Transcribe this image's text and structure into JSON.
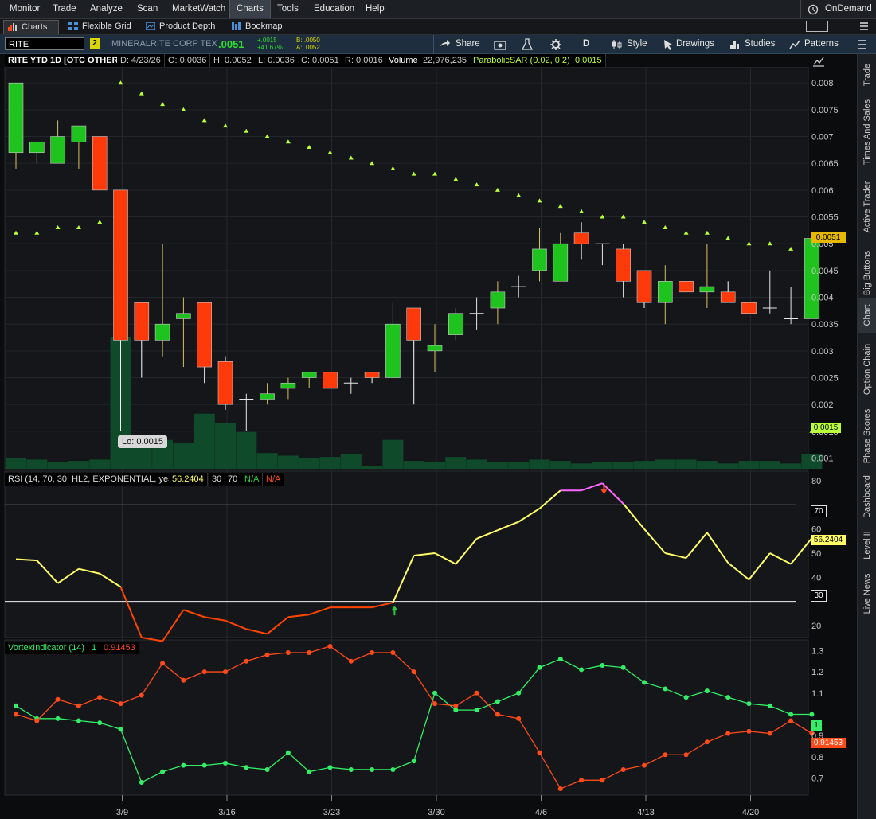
{
  "menu": {
    "items": [
      "Monitor",
      "Trade",
      "Analyze",
      "Scan",
      "MarketWatch",
      "Charts",
      "Tools",
      "Education",
      "Help"
    ],
    "active": "Charts",
    "ondemand": "OnDemand"
  },
  "subtabs": [
    "Charts",
    "Flexible Grid",
    "Product Depth",
    "Bookmap"
  ],
  "toolbar": {
    "symbol": "RITE",
    "link": "2",
    "company": "MINERALRITE CORP TEX",
    "last": ".0051",
    "change": "+.0015",
    "pct": "+41.67%",
    "bid": "B: .0050",
    "ask": "A: .0052",
    "share": "Share",
    "period": "D",
    "style": "Style",
    "drawings": "Drawings",
    "studies": "Studies",
    "patterns": "Patterns"
  },
  "header": {
    "title": "RITE YTD 1D [OTC OTHER]",
    "date": "D: 4/23/26",
    "open": "O: 0.0036",
    "high": "H: 0.0052",
    "low": "L: 0.0036",
    "close": "C: 0.0051",
    "range": "R: 0.0016",
    "volume_label": "Volume",
    "volume": "22,976,235",
    "sar_label": "ParabolicSAR (0.02, 0.2)",
    "sar_value": "0.0015"
  },
  "price_axis": [
    "0.008",
    "0.0075",
    "0.007",
    "0.0065",
    "0.006",
    "0.0055",
    "0.005",
    "0.0045",
    "0.004",
    "0.0035",
    "0.003",
    "0.0025",
    "0.002",
    "0.0015",
    "0.001"
  ],
  "price_badges": {
    "last": "0.0051",
    "sar": "0.0015"
  },
  "lo_label": "Lo: 0.0015",
  "rsi": {
    "label": "RSI (14, 70, 30, HL2, EXPONENTIAL, yes)",
    "value": "56.2404",
    "low": "30",
    "high": "70",
    "na1": "N/A",
    "na2": "N/A",
    "axis": [
      "80",
      "70",
      "60",
      "50",
      "40",
      "30",
      "20"
    ]
  },
  "vortex": {
    "label": "VortexIndicator (14)",
    "plus": "1",
    "minus": "0.91453",
    "axis": [
      "1.3",
      "1.2",
      "1.1",
      "1",
      "0.9",
      "0.8",
      "0.7"
    ]
  },
  "date_axis": [
    "3/9",
    "3/16",
    "3/23",
    "3/30",
    "4/6",
    "4/13",
    "4/20"
  ],
  "sidebar": [
    "Trade",
    "Times And Sales",
    "Active Trader",
    "Big Buttons",
    "Chart",
    "Option Chain",
    "Phase Scores",
    "Dashboard",
    "Level II",
    "Live News"
  ],
  "colors": {
    "up": "#1ec31e",
    "down": "#ff3a0a",
    "sar": "#b8ff3a",
    "volume": "#0f4a2a",
    "rsi_line": "#ffff66",
    "rsi_os": "#ff4500",
    "rsi_ob": "#ff66ff",
    "vi_plus": "#33ee66",
    "vi_minus": "#ff4a1a"
  },
  "chart_data": [
    {
      "type": "candlestick",
      "title": "RITE YTD 1D [OTC OTHER]",
      "candles": [
        {
          "o": 0.0067,
          "h": 0.008,
          "l": 0.0064,
          "c": 0.008
        },
        {
          "o": 0.0067,
          "h": 0.0069,
          "l": 0.0065,
          "c": 0.0069
        },
        {
          "o": 0.0065,
          "h": 0.0073,
          "l": 0.0065,
          "c": 0.007
        },
        {
          "o": 0.0069,
          "h": 0.0072,
          "l": 0.0064,
          "c": 0.0072
        },
        {
          "o": 0.007,
          "h": 0.007,
          "l": 0.006,
          "c": 0.006
        },
        {
          "o": 0.006,
          "h": 0.006,
          "l": 0.0015,
          "c": 0.0032
        },
        {
          "o": 0.0039,
          "h": 0.0039,
          "l": 0.0025,
          "c": 0.0032
        },
        {
          "o": 0.0032,
          "h": 0.005,
          "l": 0.0029,
          "c": 0.0035
        },
        {
          "o": 0.0036,
          "h": 0.004,
          "l": 0.0027,
          "c": 0.0037
        },
        {
          "o": 0.0039,
          "h": 0.0039,
          "l": 0.0024,
          "c": 0.0027
        },
        {
          "o": 0.0028,
          "h": 0.0029,
          "l": 0.0019,
          "c": 0.002
        },
        {
          "o": 0.0021,
          "h": 0.0022,
          "l": 0.0015,
          "c": 0.0021
        },
        {
          "o": 0.0021,
          "h": 0.0024,
          "l": 0.002,
          "c": 0.0022
        },
        {
          "o": 0.0023,
          "h": 0.0025,
          "l": 0.0021,
          "c": 0.0024
        },
        {
          "o": 0.0025,
          "h": 0.0026,
          "l": 0.0023,
          "c": 0.0026
        },
        {
          "o": 0.0026,
          "h": 0.0027,
          "l": 0.0022,
          "c": 0.0023
        },
        {
          "o": 0.0024,
          "h": 0.0025,
          "l": 0.0022,
          "c": 0.0024
        },
        {
          "o": 0.0026,
          "h": 0.0026,
          "l": 0.0024,
          "c": 0.0025
        },
        {
          "o": 0.0025,
          "h": 0.0039,
          "l": 0.0025,
          "c": 0.0035
        },
        {
          "o": 0.0038,
          "h": 0.0038,
          "l": 0.002,
          "c": 0.0032
        },
        {
          "o": 0.003,
          "h": 0.0035,
          "l": 0.0026,
          "c": 0.0031
        },
        {
          "o": 0.0033,
          "h": 0.0038,
          "l": 0.0032,
          "c": 0.0037
        },
        {
          "o": 0.0037,
          "h": 0.004,
          "l": 0.0034,
          "c": 0.0037
        },
        {
          "o": 0.0038,
          "h": 0.0043,
          "l": 0.0035,
          "c": 0.0041
        },
        {
          "o": 0.0042,
          "h": 0.0044,
          "l": 0.004,
          "c": 0.0042
        },
        {
          "o": 0.0045,
          "h": 0.0053,
          "l": 0.0043,
          "c": 0.0049
        },
        {
          "o": 0.0043,
          "h": 0.0052,
          "l": 0.0043,
          "c": 0.005
        },
        {
          "o": 0.0052,
          "h": 0.0054,
          "l": 0.0047,
          "c": 0.005
        },
        {
          "o": 0.005,
          "h": 0.005,
          "l": 0.0046,
          "c": 0.005
        },
        {
          "o": 0.0049,
          "h": 0.005,
          "l": 0.004,
          "c": 0.0043
        },
        {
          "o": 0.0045,
          "h": 0.0045,
          "l": 0.0038,
          "c": 0.0039
        },
        {
          "o": 0.0039,
          "h": 0.0046,
          "l": 0.0035,
          "c": 0.0043
        },
        {
          "o": 0.0043,
          "h": 0.0043,
          "l": 0.0041,
          "c": 0.0041
        },
        {
          "o": 0.0041,
          "h": 0.005,
          "l": 0.0038,
          "c": 0.0042
        },
        {
          "o": 0.0041,
          "h": 0.0043,
          "l": 0.0039,
          "c": 0.0039
        },
        {
          "o": 0.0039,
          "h": 0.0039,
          "l": 0.0033,
          "c": 0.0037
        },
        {
          "o": 0.0038,
          "h": 0.0045,
          "l": 0.0037,
          "c": 0.0038
        },
        {
          "o": 0.0036,
          "h": 0.0042,
          "l": 0.0035,
          "c": 0.0036
        },
        {
          "o": 0.0036,
          "h": 0.0052,
          "l": 0.0036,
          "c": 0.0051
        }
      ],
      "sar": [
        0.0052,
        0.0052,
        0.0053,
        0.0053,
        0.0054,
        0.008,
        0.0078,
        0.0076,
        0.0075,
        0.0073,
        0.0072,
        0.0071,
        0.007,
        0.0069,
        0.0068,
        0.0067,
        0.0066,
        0.0065,
        0.0064,
        0.0063,
        0.0063,
        0.0062,
        0.0061,
        0.006,
        0.0059,
        0.0058,
        0.0057,
        0.0056,
        0.0055,
        0.0055,
        0.0054,
        0.0053,
        0.0052,
        0.0052,
        0.0051,
        0.005,
        0.005,
        0.0049,
        0.0015
      ],
      "volume_rel": [
        0.08,
        0.07,
        0.05,
        0.06,
        0.07,
        1.0,
        0.25,
        0.22,
        0.2,
        0.42,
        0.35,
        0.28,
        0.12,
        0.1,
        0.08,
        0.09,
        0.11,
        0.02,
        0.22,
        0.06,
        0.05,
        0.09,
        0.07,
        0.05,
        0.05,
        0.07,
        0.06,
        0.04,
        0.05,
        0.05,
        0.06,
        0.07,
        0.07,
        0.06,
        0.04,
        0.06,
        0.06,
        0.04,
        0.11
      ],
      "ylim": [
        0.0008,
        0.0083
      ]
    },
    {
      "type": "line",
      "title": "RSI (14, 70, 30, HL2, EXPONENTIAL, yes)",
      "ylim": [
        15,
        84
      ],
      "values": [
        47.5,
        47,
        37.5,
        43.5,
        41.5,
        36,
        15,
        13.5,
        26.5,
        23.5,
        22,
        18.5,
        16.5,
        23.5,
        24.5,
        27.5,
        27.5,
        27.5,
        29.5,
        49,
        50,
        45.5,
        56,
        59.5,
        63,
        68.5,
        76,
        76,
        79,
        70.5,
        60,
        50,
        48,
        58.5,
        46,
        39,
        50,
        45.5,
        56.24
      ]
    },
    {
      "type": "line",
      "title": "VortexIndicator (14)",
      "ylim": [
        0.62,
        1.35
      ],
      "series": [
        {
          "name": "1",
          "values": [
            1.04,
            0.98,
            0.98,
            0.97,
            0.96,
            0.93,
            0.68,
            0.73,
            0.76,
            0.76,
            0.77,
            0.75,
            0.74,
            0.82,
            0.73,
            0.75,
            0.74,
            0.74,
            0.74,
            0.78,
            1.1,
            1.02,
            1.02,
            1.06,
            1.1,
            1.22,
            1.26,
            1.21,
            1.23,
            1.22,
            1.15,
            1.12,
            1.08,
            1.11,
            1.08,
            1.05,
            1.04,
            1.0,
            1.0
          ]
        },
        {
          "name": "0.91453",
          "values": [
            1.0,
            0.97,
            1.07,
            1.04,
            1.08,
            1.05,
            1.09,
            1.24,
            1.16,
            1.2,
            1.2,
            1.25,
            1.28,
            1.29,
            1.29,
            1.32,
            1.25,
            1.29,
            1.29,
            1.2,
            1.05,
            1.04,
            1.1,
            1.0,
            0.98,
            0.82,
            0.65,
            0.69,
            0.69,
            0.74,
            0.76,
            0.81,
            0.81,
            0.87,
            0.91,
            0.92,
            0.91,
            0.97,
            0.91
          ]
        }
      ]
    }
  ]
}
